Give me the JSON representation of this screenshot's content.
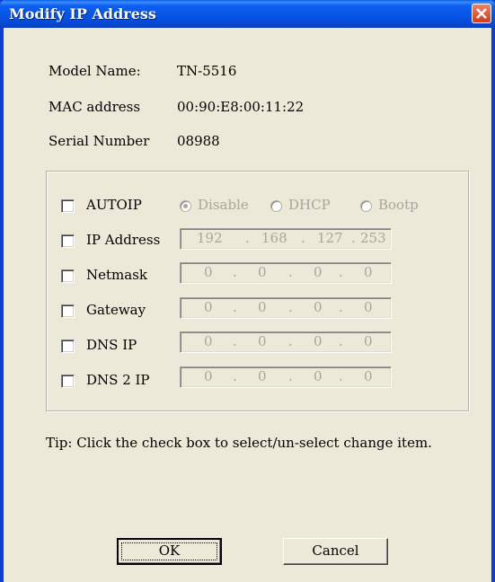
{
  "window": {
    "title": "Modify IP Address"
  },
  "info": {
    "model_label": "Model Name:",
    "model_value": "TN-5516",
    "mac_label": "MAC address",
    "mac_value": "00:90:E8:00:11:22",
    "serial_label": "Serial Number",
    "serial_value": "08988"
  },
  "settings": {
    "autoip_label": "AUTOIP",
    "radio_disable": "Disable",
    "radio_dhcp": "DHCP",
    "radio_bootp": "Bootp",
    "rows": [
      {
        "label": "IP Address",
        "octets": [
          "192",
          "168",
          "127",
          "253"
        ]
      },
      {
        "label": "Netmask",
        "octets": [
          "0",
          "0",
          "0",
          "0"
        ]
      },
      {
        "label": "Gateway",
        "octets": [
          "0",
          "0",
          "0",
          "0"
        ]
      },
      {
        "label": "DNS IP",
        "octets": [
          "0",
          "0",
          "0",
          "0"
        ]
      },
      {
        "label": "DNS 2 IP",
        "octets": [
          "0",
          "0",
          "0",
          "0"
        ]
      }
    ]
  },
  "tip": "Tip: Click the check box to select/un-select change item.",
  "buttons": {
    "ok": "OK",
    "cancel": "Cancel"
  },
  "icons": {
    "close": "close-icon"
  },
  "colors": {
    "titlebar": "#0653e6",
    "close": "#cf3b1a",
    "background": "#ece9d8",
    "disabled_text": "#a8a69c"
  }
}
